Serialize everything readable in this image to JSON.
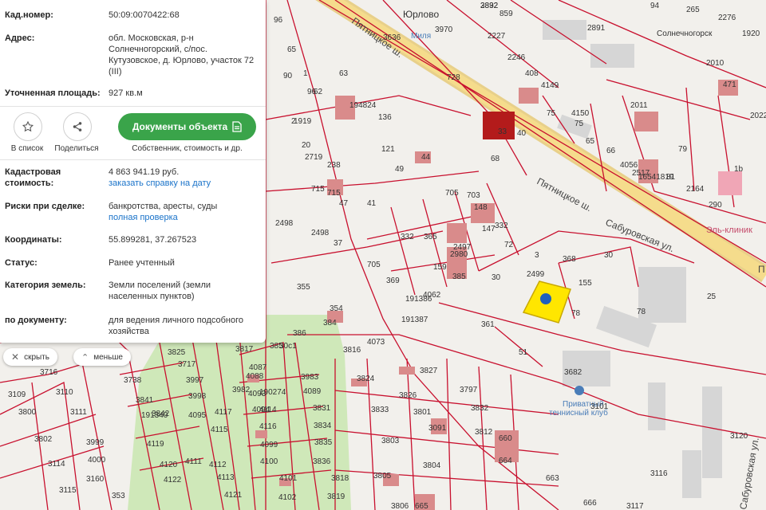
{
  "panel": {
    "cadastral_number": {
      "label": "Кад.номер:",
      "value": "50:09:0070422:68"
    },
    "address": {
      "label": "Адрес:",
      "value": "обл. Московская, р-н Солнечногорский, с/пос. Кутузовское, д. Юрлово, участок 72 (III)"
    },
    "area": {
      "label": "Уточненная площадь:",
      "value": "927 кв.м"
    },
    "actions": {
      "add_to_list": "В список",
      "share": "Поделиться",
      "documents_button": "Документы объекта",
      "documents_sub": "Собственник, стоимость и др."
    },
    "cadastral_value": {
      "label_line1": "Кадастровая",
      "label_line2": "стоимость:",
      "value": "4 863 941.19 руб.",
      "link": "заказать справку на дату"
    },
    "risks": {
      "label": "Риски при сделке:",
      "value": "банкротства, аресты, суды",
      "link": "полная проверка"
    },
    "coordinates": {
      "label": "Координаты:",
      "value": "55.899281, 37.267523"
    },
    "status": {
      "label": "Статус:",
      "value": "Ранее учтенный"
    },
    "land_category": {
      "label": "Категория земель:",
      "value": "Земли поселений (земли населенных пунктов)"
    },
    "by_document": {
      "label": "по документу:",
      "value": "для ведения личного подсобного хозяйства"
    }
  },
  "controls": {
    "hide": "скрыть",
    "less": "меньше"
  },
  "map": {
    "streets": {
      "pyatnitskoe_1": "Пятницкое ш.",
      "pyatnitskoe_2": "Пятницкое ш.",
      "saburovskaya": "Сабуровская ул.",
      "saburovskaya_v": "Сабуровская ул.",
      "street_p": "П"
    },
    "places": {
      "yurlovo": "Юрлово",
      "mila": "Миля",
      "el_klinik": "Эль-клиник",
      "club_line1": "Приватный",
      "club_line2": "теннисный клуб"
    },
    "parcel_labels": [
      "2892",
      "859",
      "94",
      "265",
      "2276",
      "2891",
      "96",
      "65",
      "1",
      "2",
      "Солнечногорск",
      "1920",
      "3636",
      "3970",
      "2227",
      "2246",
      "75",
      "90",
      "96",
      "63",
      "62",
      "194824",
      "728",
      "408",
      "4149",
      "4150",
      "75",
      "2011",
      "2010",
      "471",
      "1919",
      "136",
      "65",
      "66",
      "79",
      "2022",
      "20",
      "121",
      "33",
      "40",
      "68",
      "4056",
      "2517",
      "16541819",
      "81",
      "2164",
      "290",
      "1b",
      "2719",
      "238",
      "49",
      "44",
      "715",
      "715",
      "47",
      "41",
      "705",
      "703",
      "148",
      "147",
      "332",
      "72",
      "332",
      "365",
      "2498",
      "2498",
      "37",
      "705",
      "2980",
      "2497",
      "3",
      "368",
      "30",
      "159",
      "369",
      "385",
      "30",
      "2499",
      "155",
      "355",
      "354",
      "384",
      "191386",
      "4062",
      "191387",
      "78",
      "78",
      "25",
      "361",
      "51",
      "3682",
      "386",
      "385",
      "30c1",
      "3817",
      "3816",
      "4073",
      "3825",
      "3717",
      "3716",
      "4087",
      "4088",
      "3983",
      "3824",
      "3827",
      "3797",
      "3109",
      "3110",
      "3738",
      "3997",
      "3982",
      "4093",
      "4089",
      "3826",
      "3832",
      "3800",
      "3111",
      "3841",
      "3998",
      "4117",
      "4094",
      "4114",
      "3831",
      "3833",
      "3801",
      "3091",
      "3101",
      "3812",
      "191340",
      "3842",
      "4095",
      "4115",
      "4116",
      "3834",
      "3802",
      "3999",
      "4119",
      "4111",
      "4099",
      "3835",
      "3803",
      "660",
      "3114",
      "4000",
      "4120",
      "4112",
      "4100",
      "3836",
      "3804",
      "664",
      "3115",
      "3160",
      "4122",
      "4113",
      "4101",
      "3818",
      "3805",
      "663",
      "3116",
      "353",
      "4121",
      "4102",
      "3819",
      "3806",
      "665",
      "666",
      "3117",
      "3120",
      "190274",
      "3832"
    ]
  },
  "colors": {
    "accent_green": "#3aa44a",
    "link_blue": "#1a73c9",
    "parcel_red": "#c8102e",
    "highlight_yellow": "#ffe600",
    "marker_blue": "#1f5fbf"
  }
}
